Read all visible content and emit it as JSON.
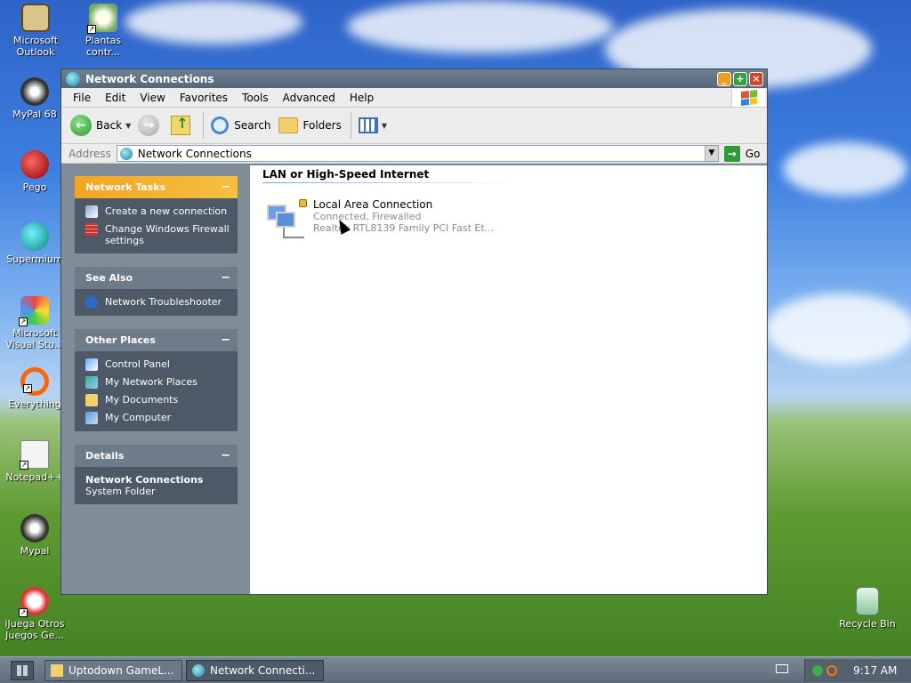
{
  "desktop": {
    "icons": [
      {
        "label": "Microsoft Outlook"
      },
      {
        "label": "Plantas contr..."
      },
      {
        "label": "MyPal 68"
      },
      {
        "label": "Pego"
      },
      {
        "label": "Supermium"
      },
      {
        "label": "Microsoft Visual Stu..."
      },
      {
        "label": "Everything"
      },
      {
        "label": "Notepad++"
      },
      {
        "label": "Mypal"
      },
      {
        "label": "iJuega Otros Juegos Ge..."
      },
      {
        "label": "Recycle Bin"
      }
    ]
  },
  "window": {
    "title": "Network Connections",
    "buttons": {
      "minimize": "_",
      "maximize": "+",
      "close": "×"
    },
    "menu": [
      "File",
      "Edit",
      "View",
      "Favorites",
      "Tools",
      "Advanced",
      "Help"
    ],
    "toolbar": {
      "back": "Back",
      "search": "Search",
      "folders": "Folders"
    },
    "address": {
      "label": "Address",
      "value": "Network Connections",
      "go": "Go"
    }
  },
  "left_pane": {
    "network_tasks": {
      "title": "Network Tasks",
      "items": [
        "Create a new connection",
        "Change Windows Firewall settings"
      ]
    },
    "see_also": {
      "title": "See Also",
      "items": [
        "Network Troubleshooter"
      ]
    },
    "other_places": {
      "title": "Other Places",
      "items": [
        "Control Panel",
        "My Network Places",
        "My Documents",
        "My Computer"
      ]
    },
    "details": {
      "title": "Details",
      "name": "Network Connections",
      "type": "System Folder"
    },
    "collapse_glyph": "−"
  },
  "content": {
    "group_header": "LAN or High-Speed Internet",
    "connection": {
      "name": "Local Area Connection",
      "status": "Connected, Firewalled",
      "device": "Realtek RTL8139 Family PCI Fast Et..."
    }
  },
  "taskbar": {
    "buttons": [
      "Uptodown GameL...",
      "Network Connecti..."
    ],
    "clock": "9:17 AM"
  },
  "colors": {
    "accent_orange": "#f3a423",
    "pane_dark": "#4d5966",
    "window_frame": "#7a8a99"
  }
}
